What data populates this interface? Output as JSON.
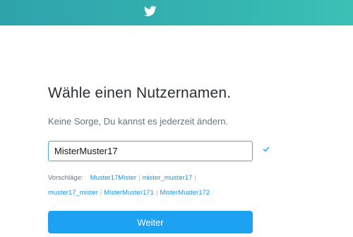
{
  "header": {
    "logo_icon": "twitter-bird-icon",
    "bar_color": "#35b3b0"
  },
  "main": {
    "title": "Wähle einen Nutzernamen.",
    "subtitle": "Keine Sorge, Du kannst es jederzeit ändern.",
    "username": {
      "value": "MisterMuster17",
      "valid_icon": "checkmark-icon",
      "valid_color": "#1da1f2"
    },
    "suggestions": {
      "label": "Vorschläge:",
      "items": [
        "Muster17Mister",
        "mister_muster17",
        "muster17_mister",
        "MisterMuster171",
        "MisterMuster172"
      ]
    },
    "next_button": {
      "label": "Weiter",
      "color": "#1da1f2"
    }
  }
}
